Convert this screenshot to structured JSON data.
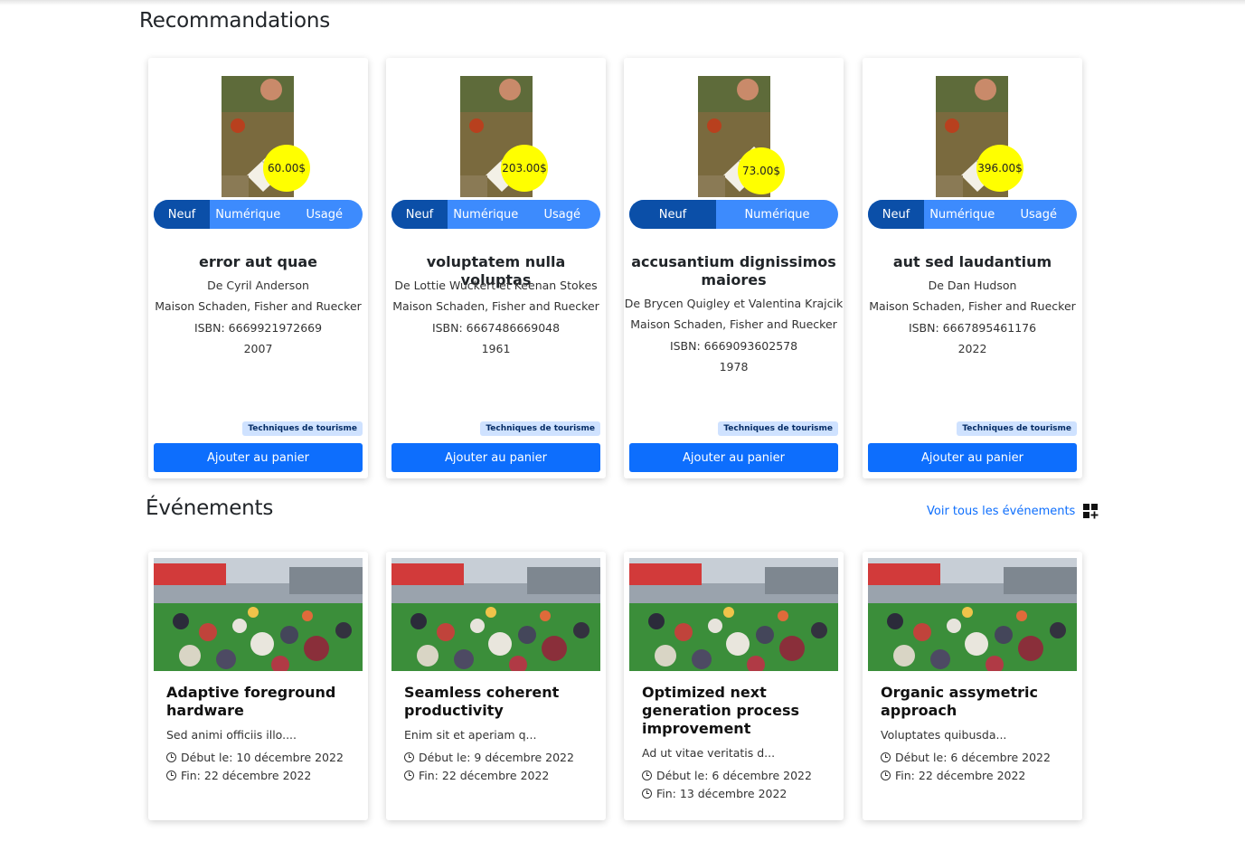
{
  "sections": {
    "recommendations_title": "Recommandations",
    "events_title": "Événements",
    "see_all_events": "Voir tous les événements"
  },
  "books": [
    {
      "price": "60.00$",
      "formats": [
        "Neuf",
        "Numérique",
        "Usagé"
      ],
      "title": "error aut quae",
      "author": "De Cyril Anderson",
      "publisher": "Maison Schaden, Fisher and Ruecker",
      "isbn": "ISBN: 6669921972669",
      "year": "2007",
      "category": "Techniques de tourisme",
      "button": "Ajouter au panier"
    },
    {
      "price": "203.00$",
      "formats": [
        "Neuf",
        "Numérique",
        "Usagé"
      ],
      "title": "voluptatem nulla voluptas",
      "author": "De Lottie Wuckert et Keenan Stokes",
      "publisher": "Maison Schaden, Fisher and Ruecker",
      "isbn": "ISBN: 6667486669048",
      "year": "1961",
      "category": "Techniques de tourisme",
      "button": "Ajouter au panier"
    },
    {
      "price": "73.00$",
      "formats": [
        "Neuf",
        "Numérique"
      ],
      "title": "accusantium dignissimos maiores",
      "author": "De Brycen Quigley et Valentina Krajcik",
      "publisher": "Maison Schaden, Fisher and Ruecker",
      "isbn": "ISBN: 6669093602578",
      "year": "1978",
      "category": "Techniques de tourisme",
      "button": "Ajouter au panier"
    },
    {
      "price": "396.00$",
      "formats": [
        "Neuf",
        "Numérique",
        "Usagé"
      ],
      "title": "aut sed laudantium",
      "author": "De Dan Hudson",
      "publisher": "Maison Schaden, Fisher and Ruecker",
      "isbn": "ISBN: 6667895461176",
      "year": "2022",
      "category": "Techniques de tourisme",
      "button": "Ajouter au panier"
    }
  ],
  "events": [
    {
      "title": "Adaptive foreground hardware",
      "description": "Sed animi officiis illo....",
      "start": "Début le: 10 décembre 2022",
      "end": "Fin: 22 décembre 2022"
    },
    {
      "title": "Seamless coherent productivity",
      "description": "Enim sit et aperiam q...",
      "start": "Début le: 9 décembre 2022",
      "end": "Fin: 22 décembre 2022"
    },
    {
      "title": "Optimized next generation process improvement",
      "description": "Ad ut vitae veritatis d...",
      "start": "Début le: 6 décembre 2022",
      "end": "Fin: 13 décembre 2022"
    },
    {
      "title": "Organic assymetric approach",
      "description": "Voluptates quibusda...",
      "start": "Début le: 6 décembre 2022",
      "end": "Fin: 22 décembre 2022"
    }
  ],
  "colors": {
    "primary": "#0d6efd",
    "format_bar": "#3d8bfd",
    "format_active": "#0b4fa8",
    "price_badge": "#ffff00",
    "category_badge": "#cfe2ff"
  },
  "icons": {
    "see_all": "grid-plus-icon",
    "date": "clock-icon"
  }
}
